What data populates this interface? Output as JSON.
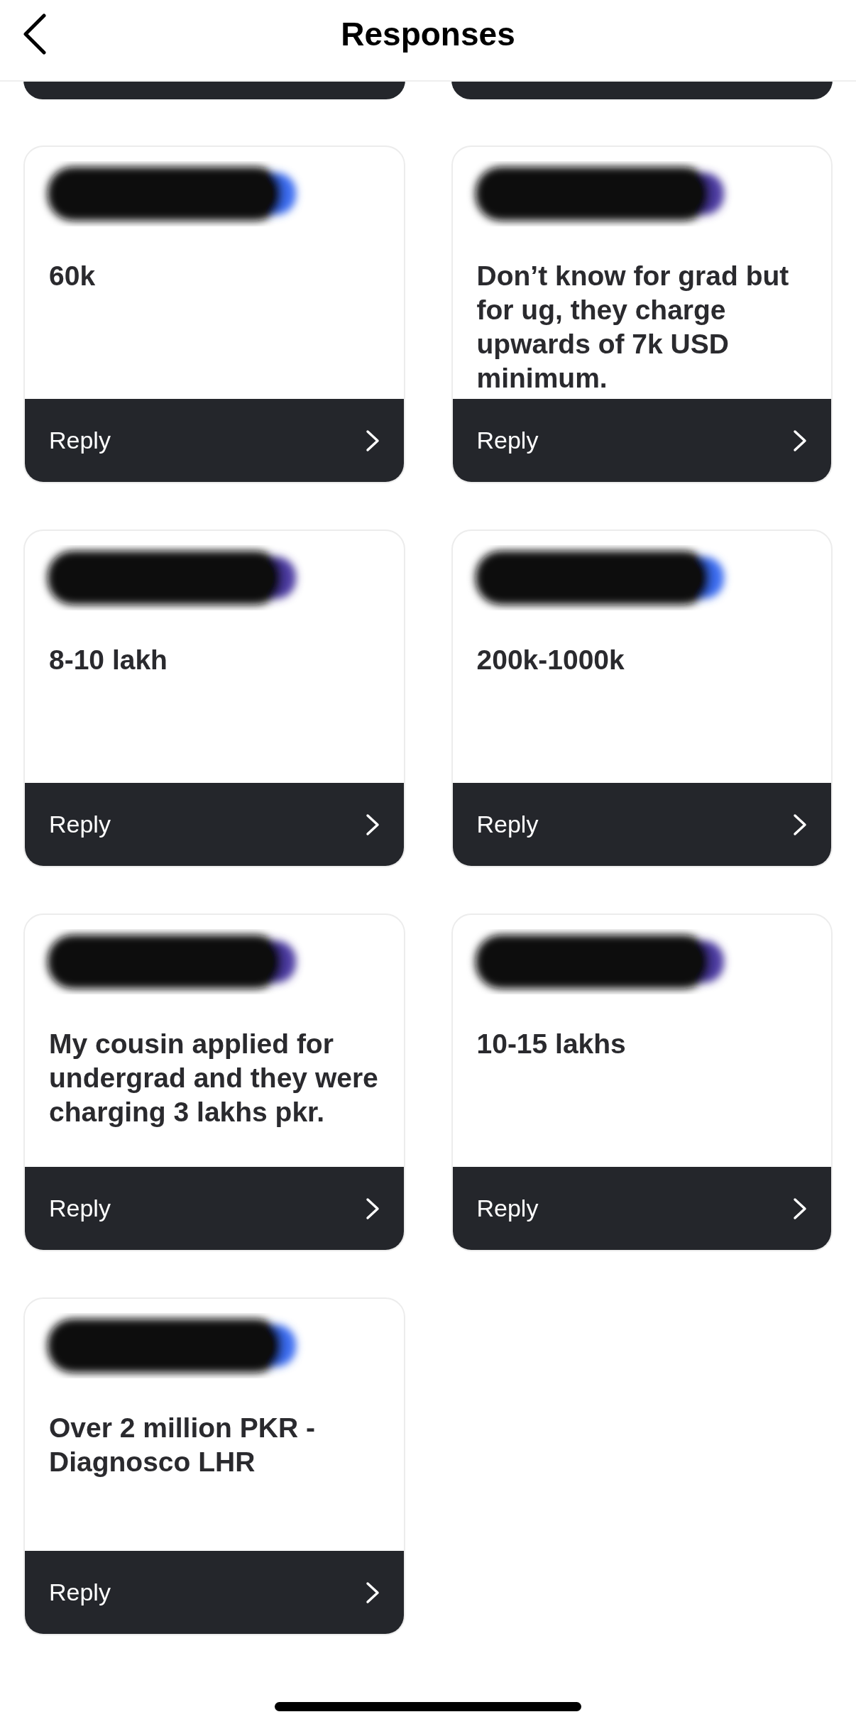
{
  "header": {
    "title": "Responses"
  },
  "responses": [
    {
      "text": "60k",
      "action": "Reply"
    },
    {
      "text": "Don’t know for grad but for ug, they charge upwards of 7k USD minimum.",
      "action": "Reply"
    },
    {
      "text": "8-10 lakh",
      "action": "Reply"
    },
    {
      "text": "200k-1000k",
      "action": "Reply"
    },
    {
      "text": "My cousin applied for undergrad and they were charging 3 lakhs pkr.",
      "action": "Reply"
    },
    {
      "text": "10-15 lakhs",
      "action": "Reply"
    },
    {
      "text": "Over 2 million PKR - Diagnosco LHR",
      "action": "Reply"
    }
  ]
}
